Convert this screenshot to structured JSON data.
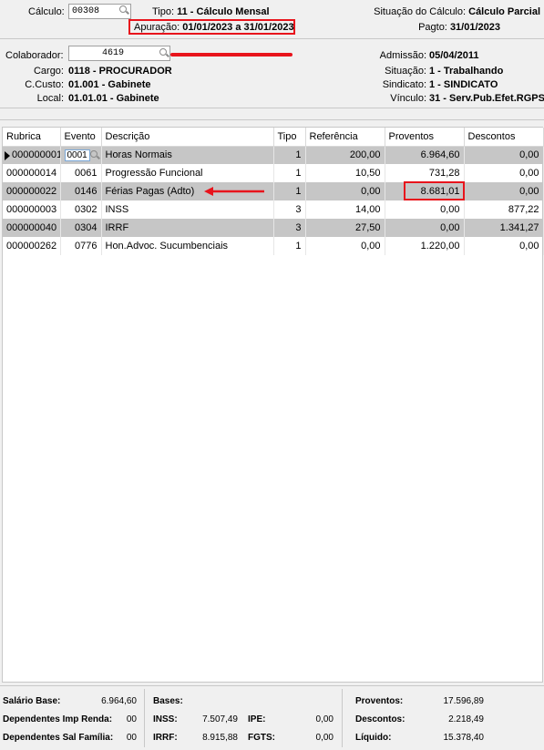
{
  "header": {
    "calculo_label": "Cálculo:",
    "calculo_value": "00308",
    "tipo_label": "Tipo:",
    "tipo_value": "11 - Cálculo Mensal",
    "apuracao_label": "Apuração:",
    "apuracao_value": "01/01/2023 a 31/01/2023",
    "situacao_calculo_label": "Situação do Cálculo:",
    "situacao_calculo_value": "Cálculo Parcial",
    "pagto_label": "Pagto:",
    "pagto_value": "31/01/2023"
  },
  "colaborador": {
    "label": "Colaborador:",
    "value": "4619",
    "cargo_label": "Cargo:",
    "cargo_value": "0118 - PROCURADOR",
    "ccusto_label": "C.Custo:",
    "ccusto_value": "01.001 - Gabinete",
    "local_label": "Local:",
    "local_value": "01.01.01 - Gabinete",
    "admissao_label": "Admissão:",
    "admissao_value": "05/04/2011",
    "situacao_label": "Situação:",
    "situacao_value": "1 - Trabalhando",
    "sindicato_label": "Sindicato:",
    "sindicato_value": "1 - SINDICATO",
    "vinculo_label": "Vínculo:",
    "vinculo_value": "31 - Serv.Pub.Efet.RGPS"
  },
  "table": {
    "columns": [
      "Rubrica",
      "Evento",
      "Descrição",
      "Tipo",
      "Referência",
      "Proventos",
      "Descontos"
    ],
    "rows": [
      {
        "rubrica": "000000001",
        "evento": "0001",
        "descricao": "Horas Normais",
        "tipo": "1",
        "referencia": "200,00",
        "proventos": "6.964,60",
        "descontos": "0,00"
      },
      {
        "rubrica": "000000014",
        "evento": "0061",
        "descricao": "Progressão Funcional",
        "tipo": "1",
        "referencia": "10,50",
        "proventos": "731,28",
        "descontos": "0,00"
      },
      {
        "rubrica": "000000022",
        "evento": "0146",
        "descricao": "Férias Pagas (Adto)",
        "tipo": "1",
        "referencia": "0,00",
        "proventos": "8.681,01",
        "descontos": "0,00"
      },
      {
        "rubrica": "000000003",
        "evento": "0302",
        "descricao": "INSS",
        "tipo": "3",
        "referencia": "14,00",
        "proventos": "0,00",
        "descontos": "877,22"
      },
      {
        "rubrica": "000000040",
        "evento": "0304",
        "descricao": "IRRF",
        "tipo": "3",
        "referencia": "27,50",
        "proventos": "0,00",
        "descontos": "1.341,27"
      },
      {
        "rubrica": "000000262",
        "evento": "0776",
        "descricao": "Hon.Advoc. Sucumbenciais",
        "tipo": "1",
        "referencia": "0,00",
        "proventos": "1.220,00",
        "descontos": "0,00"
      }
    ]
  },
  "footer": {
    "salario_base_label": "Salário Base:",
    "salario_base_value": "6.964,60",
    "dep_ir_label": "Dependentes Imp Renda:",
    "dep_ir_value": "00",
    "dep_sf_label": "Dependentes Sal Família:",
    "dep_sf_value": "00",
    "bases_label": "Bases:",
    "inss_label": "INSS:",
    "inss_value": "7.507,49",
    "irrf_label": "IRRF:",
    "irrf_value": "8.915,88",
    "ipe_label": "IPE:",
    "ipe_value": "0,00",
    "fgts_label": "FGTS:",
    "fgts_value": "0,00",
    "proventos_label": "Proventos:",
    "proventos_value": "17.596,89",
    "descontos_label": "Descontos:",
    "descontos_value": "2.218,49",
    "liquido_label": "Líquido:",
    "liquido_value": "15.378,40"
  },
  "colors": {
    "highlight": "#e8141c",
    "alt_row": "#c6c6c6",
    "background": "#f0f0f0"
  }
}
